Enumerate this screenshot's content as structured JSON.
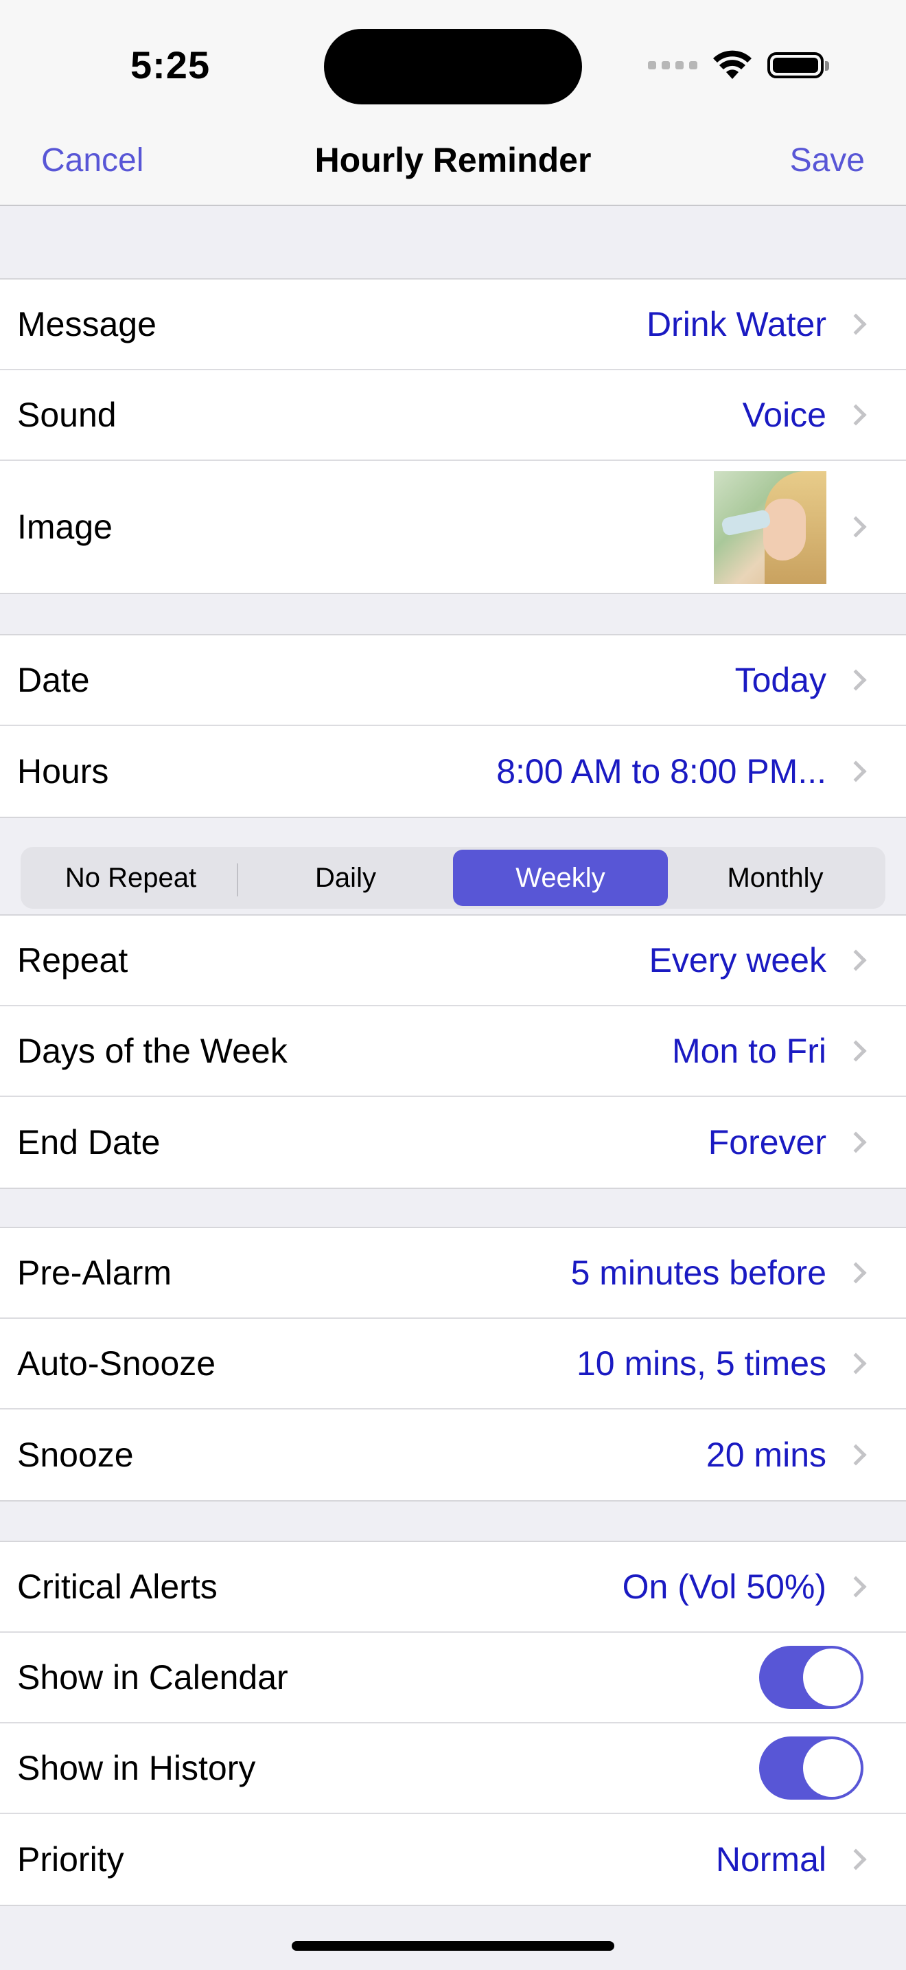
{
  "status_bar": {
    "time": "5:25"
  },
  "nav": {
    "cancel_label": "Cancel",
    "title": "Hourly Reminder",
    "save_label": "Save"
  },
  "group1": {
    "message": {
      "label": "Message",
      "value": "Drink Water"
    },
    "sound": {
      "label": "Sound",
      "value": "Voice"
    },
    "image": {
      "label": "Image"
    }
  },
  "group2": {
    "date": {
      "label": "Date",
      "value": "Today"
    },
    "hours": {
      "label": "Hours",
      "value": "8:00 AM to 8:00 PM..."
    }
  },
  "repeat_segments": {
    "options": [
      "No Repeat",
      "Daily",
      "Weekly",
      "Monthly"
    ],
    "selected": "Weekly"
  },
  "group3": {
    "repeat": {
      "label": "Repeat",
      "value": "Every week"
    },
    "days": {
      "label": "Days of the Week",
      "value": "Mon to Fri"
    },
    "end_date": {
      "label": "End Date",
      "value": "Forever"
    }
  },
  "group4": {
    "pre_alarm": {
      "label": "Pre-Alarm",
      "value": "5 minutes before"
    },
    "auto_snooze": {
      "label": "Auto-Snooze",
      "value": "10 mins, 5 times"
    },
    "snooze": {
      "label": "Snooze",
      "value": "20 mins"
    }
  },
  "group5": {
    "critical_alerts": {
      "label": "Critical Alerts",
      "value": "On (Vol 50%)"
    },
    "show_calendar": {
      "label": "Show in Calendar",
      "on": true
    },
    "show_history": {
      "label": "Show in History",
      "on": true
    },
    "priority": {
      "label": "Priority",
      "value": "Normal"
    }
  },
  "colors": {
    "accent": "#5856d6",
    "value_text": "#1a1ac2",
    "background": "#efeff4"
  }
}
